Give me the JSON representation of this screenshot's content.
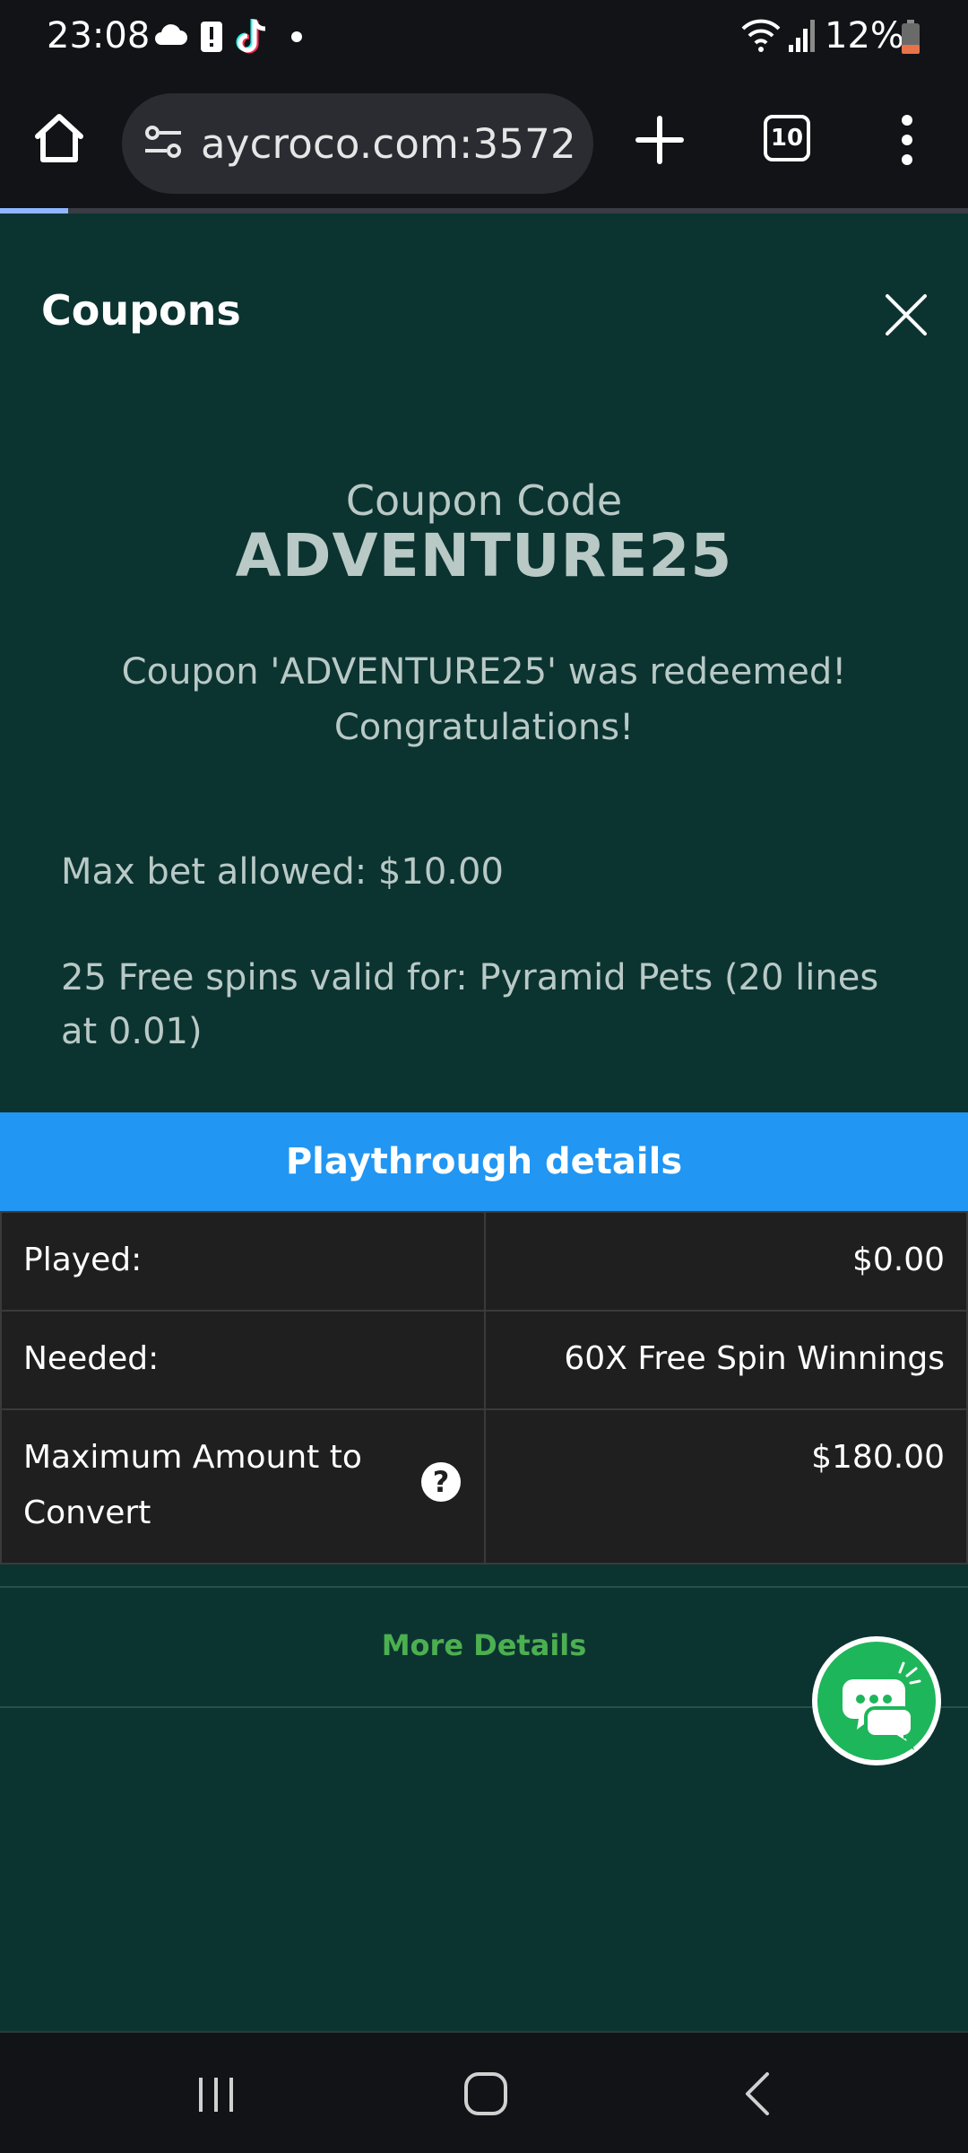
{
  "status_bar": {
    "time": "23:08",
    "battery_percent": "12%",
    "icons": [
      "cloud-icon",
      "alert-icon",
      "tiktok-icon",
      "dot-icon",
      "wifi-icon",
      "signal-icon",
      "battery-icon"
    ]
  },
  "browser": {
    "url": "aycroco.com:3572",
    "tab_count": "10",
    "icons": [
      "home-icon",
      "tune-icon",
      "plus-icon",
      "more-vert-icon"
    ],
    "load_progress": 0.07,
    "accent": "#8fb7ff"
  },
  "modal": {
    "title": "Coupons",
    "close_icon": "close-icon"
  },
  "coupon": {
    "label": "Coupon Code",
    "code": "ADVENTURE25",
    "message_line1": "Coupon 'ADVENTURE25' was redeemed!",
    "message_line2": "Congratulations!",
    "max_bet": "Max bet allowed: $10.00",
    "free_spins": "25 Free spins valid for: Pyramid Pets (20 lines at 0.01)"
  },
  "playthrough": {
    "header": "Playthrough details",
    "header_color": "#2196f3",
    "rows": [
      {
        "label": "Played:",
        "value": "$0.00"
      },
      {
        "label": "Needed:",
        "value": "60X Free Spin Winnings"
      },
      {
        "label": "Maximum Amount to Convert",
        "value": "$180.00"
      }
    ],
    "help_icon": "question-icon"
  },
  "more_details": {
    "label": "More Details",
    "color": "#4caf50"
  },
  "chat": {
    "icon": "chat-icon",
    "color": "#1eb65a"
  },
  "nav_bar": {
    "icons": [
      "recents-icon",
      "home-icon",
      "back-icon"
    ]
  }
}
